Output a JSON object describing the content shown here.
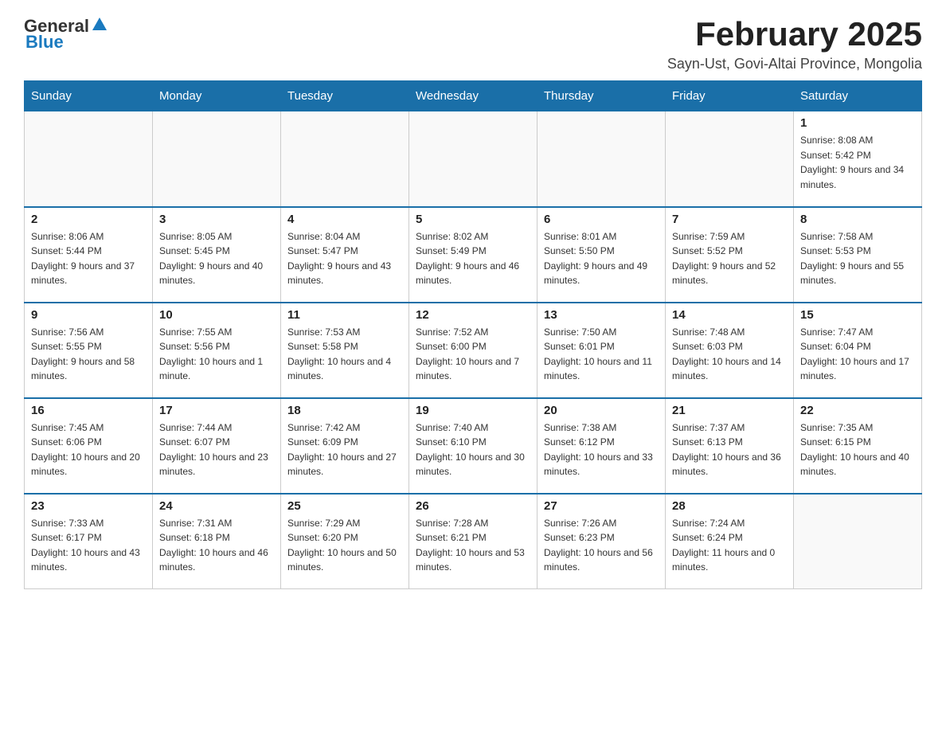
{
  "header": {
    "logo_general": "General",
    "logo_blue": "Blue",
    "month_title": "February 2025",
    "location": "Sayn-Ust, Govi-Altai Province, Mongolia"
  },
  "days_of_week": [
    "Sunday",
    "Monday",
    "Tuesday",
    "Wednesday",
    "Thursday",
    "Friday",
    "Saturday"
  ],
  "weeks": [
    [
      {
        "day": "",
        "info": ""
      },
      {
        "day": "",
        "info": ""
      },
      {
        "day": "",
        "info": ""
      },
      {
        "day": "",
        "info": ""
      },
      {
        "day": "",
        "info": ""
      },
      {
        "day": "",
        "info": ""
      },
      {
        "day": "1",
        "info": "Sunrise: 8:08 AM\nSunset: 5:42 PM\nDaylight: 9 hours and 34 minutes."
      }
    ],
    [
      {
        "day": "2",
        "info": "Sunrise: 8:06 AM\nSunset: 5:44 PM\nDaylight: 9 hours and 37 minutes."
      },
      {
        "day": "3",
        "info": "Sunrise: 8:05 AM\nSunset: 5:45 PM\nDaylight: 9 hours and 40 minutes."
      },
      {
        "day": "4",
        "info": "Sunrise: 8:04 AM\nSunset: 5:47 PM\nDaylight: 9 hours and 43 minutes."
      },
      {
        "day": "5",
        "info": "Sunrise: 8:02 AM\nSunset: 5:49 PM\nDaylight: 9 hours and 46 minutes."
      },
      {
        "day": "6",
        "info": "Sunrise: 8:01 AM\nSunset: 5:50 PM\nDaylight: 9 hours and 49 minutes."
      },
      {
        "day": "7",
        "info": "Sunrise: 7:59 AM\nSunset: 5:52 PM\nDaylight: 9 hours and 52 minutes."
      },
      {
        "day": "8",
        "info": "Sunrise: 7:58 AM\nSunset: 5:53 PM\nDaylight: 9 hours and 55 minutes."
      }
    ],
    [
      {
        "day": "9",
        "info": "Sunrise: 7:56 AM\nSunset: 5:55 PM\nDaylight: 9 hours and 58 minutes."
      },
      {
        "day": "10",
        "info": "Sunrise: 7:55 AM\nSunset: 5:56 PM\nDaylight: 10 hours and 1 minute."
      },
      {
        "day": "11",
        "info": "Sunrise: 7:53 AM\nSunset: 5:58 PM\nDaylight: 10 hours and 4 minutes."
      },
      {
        "day": "12",
        "info": "Sunrise: 7:52 AM\nSunset: 6:00 PM\nDaylight: 10 hours and 7 minutes."
      },
      {
        "day": "13",
        "info": "Sunrise: 7:50 AM\nSunset: 6:01 PM\nDaylight: 10 hours and 11 minutes."
      },
      {
        "day": "14",
        "info": "Sunrise: 7:48 AM\nSunset: 6:03 PM\nDaylight: 10 hours and 14 minutes."
      },
      {
        "day": "15",
        "info": "Sunrise: 7:47 AM\nSunset: 6:04 PM\nDaylight: 10 hours and 17 minutes."
      }
    ],
    [
      {
        "day": "16",
        "info": "Sunrise: 7:45 AM\nSunset: 6:06 PM\nDaylight: 10 hours and 20 minutes."
      },
      {
        "day": "17",
        "info": "Sunrise: 7:44 AM\nSunset: 6:07 PM\nDaylight: 10 hours and 23 minutes."
      },
      {
        "day": "18",
        "info": "Sunrise: 7:42 AM\nSunset: 6:09 PM\nDaylight: 10 hours and 27 minutes."
      },
      {
        "day": "19",
        "info": "Sunrise: 7:40 AM\nSunset: 6:10 PM\nDaylight: 10 hours and 30 minutes."
      },
      {
        "day": "20",
        "info": "Sunrise: 7:38 AM\nSunset: 6:12 PM\nDaylight: 10 hours and 33 minutes."
      },
      {
        "day": "21",
        "info": "Sunrise: 7:37 AM\nSunset: 6:13 PM\nDaylight: 10 hours and 36 minutes."
      },
      {
        "day": "22",
        "info": "Sunrise: 7:35 AM\nSunset: 6:15 PM\nDaylight: 10 hours and 40 minutes."
      }
    ],
    [
      {
        "day": "23",
        "info": "Sunrise: 7:33 AM\nSunset: 6:17 PM\nDaylight: 10 hours and 43 minutes."
      },
      {
        "day": "24",
        "info": "Sunrise: 7:31 AM\nSunset: 6:18 PM\nDaylight: 10 hours and 46 minutes."
      },
      {
        "day": "25",
        "info": "Sunrise: 7:29 AM\nSunset: 6:20 PM\nDaylight: 10 hours and 50 minutes."
      },
      {
        "day": "26",
        "info": "Sunrise: 7:28 AM\nSunset: 6:21 PM\nDaylight: 10 hours and 53 minutes."
      },
      {
        "day": "27",
        "info": "Sunrise: 7:26 AM\nSunset: 6:23 PM\nDaylight: 10 hours and 56 minutes."
      },
      {
        "day": "28",
        "info": "Sunrise: 7:24 AM\nSunset: 6:24 PM\nDaylight: 11 hours and 0 minutes."
      },
      {
        "day": "",
        "info": ""
      }
    ]
  ]
}
